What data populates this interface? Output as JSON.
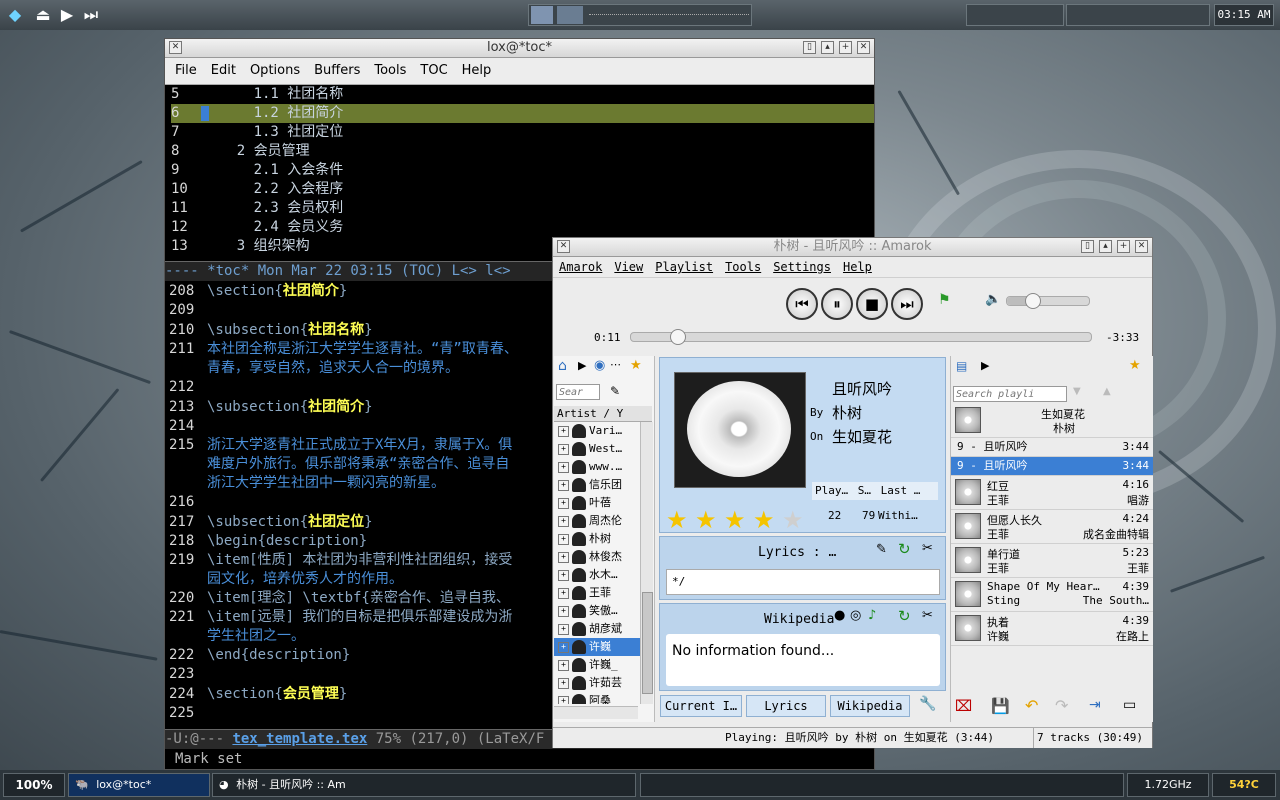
{
  "top_panel": {
    "clock": "03:15 AM"
  },
  "bottom_panel": {
    "zoom": "100%",
    "tasks": [
      {
        "label": "lox@*toc*"
      },
      {
        "label": "朴树 - 且听风吟 :: Am"
      }
    ],
    "cpu_freq": "1.72GHz",
    "temperature": "54?C"
  },
  "emacs": {
    "title": "lox@*toc*",
    "menu": [
      "File",
      "Edit",
      "Options",
      "Buffers",
      "Tools",
      "TOC",
      "Help"
    ],
    "toc_lines": [
      {
        "num": "5",
        "text": "      1.1 社团名称"
      },
      {
        "num": "6",
        "text": "      1.2 社团简介"
      },
      {
        "num": "7",
        "text": "      1.3 社团定位"
      },
      {
        "num": "8",
        "text": "    2 会员管理"
      },
      {
        "num": "9",
        "text": "      2.1 入会条件"
      },
      {
        "num": "10",
        "text": "      2.2 入会程序"
      },
      {
        "num": "11",
        "text": "      2.3 会员权利"
      },
      {
        "num": "12",
        "text": "      2.4 会员义务"
      },
      {
        "num": "13",
        "text": "    3 组织架构"
      }
    ],
    "toc_modeline": "---- *toc*     Mon Mar 22 03:15   (TOC)  L<>  l<>",
    "source_lines": [
      {
        "num": "208",
        "pre": "\\section{",
        "bold": "社团简介",
        "post": "}"
      },
      {
        "num": "209",
        "plain": ""
      },
      {
        "num": "210",
        "pre": "\\subsection{",
        "bold": "社团名称",
        "post": "}"
      },
      {
        "num": "211",
        "plain": "本社团全称是浙江大学学生逐青社。“青”取青春、"
      },
      {
        "num": "",
        "plain": "青春，享受自然，追求天人合一的境界。"
      },
      {
        "num": "212",
        "plain": ""
      },
      {
        "num": "213",
        "pre": "\\subsection{",
        "bold": "社团简介",
        "post": "}"
      },
      {
        "num": "214",
        "plain": ""
      },
      {
        "num": "215",
        "plain": "浙江大学逐青社正式成立于X年X月，隶属于X。俱"
      },
      {
        "num": "",
        "plain": "难度户外旅行。俱乐部将秉承“亲密合作、追寻自"
      },
      {
        "num": "",
        "plain": "浙江大学学生社团中一颗闪亮的新星。"
      },
      {
        "num": "216",
        "plain": ""
      },
      {
        "num": "217",
        "pre": "\\subsection{",
        "bold": "社团定位",
        "post": "}"
      },
      {
        "num": "218",
        "plain": "\\begin{description}"
      },
      {
        "num": "219",
        "plain": "\\item[性质] 本社团为非营利性社团组织，接受"
      },
      {
        "num": "",
        "plain": "园文化，培养优秀人才的作用。"
      },
      {
        "num": "220",
        "plain": "\\item[理念] \\textbf{亲密合作、追寻自我、"
      },
      {
        "num": "221",
        "plain": "\\item[远景] 我们的目标是把俱乐部建设成为浙"
      },
      {
        "num": "",
        "plain": "学生社团之一。"
      },
      {
        "num": "222",
        "plain": "\\end{description}"
      },
      {
        "num": "223",
        "plain": ""
      },
      {
        "num": "224",
        "pre": "\\section{",
        "bold": "会员管理",
        "post": "}"
      },
      {
        "num": "225",
        "plain": ""
      }
    ],
    "main_modeline_pre": "-U:@---  ",
    "main_modeline_file": "tex_template.tex",
    "main_modeline_post": "  75% (217,0)    (LaTeX/F",
    "minibuffer": "Mark set"
  },
  "amarok": {
    "title": "朴树 - 且听风吟  ::  Amarok",
    "menu": [
      "Amarok",
      "View",
      "Playlist",
      "Tools",
      "Settings",
      "Help"
    ],
    "time_elapsed": "0:11",
    "time_remaining": "-3:33",
    "progress": 0.05,
    "volume": 0.3,
    "collection_search_placeholder": "Sear",
    "artist_column_header": "Artist / Y",
    "artists": [
      "Vari…",
      "West…",
      "www.…",
      "信乐团",
      "叶蓓",
      "周杰伦",
      "朴树",
      "林俊杰",
      "水木…",
      "王菲",
      "笑傲…",
      "胡彦斌",
      "许巍",
      "许巍_",
      "许茹芸",
      "阿桑"
    ],
    "selected_artist_index": 12,
    "now_playing": {
      "title": "且听风吟",
      "by_label": "By",
      "artist": "朴树",
      "on_label": "On",
      "album": "生如夏花",
      "stats_headers": [
        "Play…",
        "S…",
        "Last …"
      ],
      "play_count": "22",
      "score": "79",
      "last_played": "Withi…",
      "rating": 4
    },
    "lyrics_title": "Lyrics : …",
    "lyrics_text": "*/",
    "wikipedia_title": "Wikipedia",
    "wikipedia_text": "No information found...",
    "tabs": [
      "Current I…",
      "Lyrics",
      "Wikipedia"
    ],
    "playlist_search_placeholder": "Search playli",
    "playlist": [
      {
        "title": "生如夏花",
        "artist": "朴树",
        "album_row": true
      },
      {
        "line": "9 - 且听风吟",
        "time": "3:44"
      },
      {
        "line": "9 - 且听风吟",
        "time": "3:44",
        "selected": true
      },
      {
        "title": "红豆",
        "time": "4:16",
        "artist": "王菲",
        "album": "唱游"
      },
      {
        "title": "但愿人长久",
        "time": "4:24",
        "artist": "王菲",
        "album": "成名金曲特辑"
      },
      {
        "title": "单行道",
        "time": "5:23",
        "artist": "王菲",
        "album": "王菲"
      },
      {
        "title": "Shape Of My Hear…",
        "time": "4:39",
        "artist": "Sting",
        "album": "The South…"
      },
      {
        "title": "执着",
        "time": "4:39",
        "artist": "许巍",
        "album": "在路上"
      }
    ],
    "status_playing": "Playing: 且听风吟 by 朴树 on 生如夏花 (3:44)",
    "status_tracks": "7 tracks (30:49)",
    "colors": {
      "accent": "#3b7fd4",
      "highlight_line": "#6b7a30"
    }
  }
}
